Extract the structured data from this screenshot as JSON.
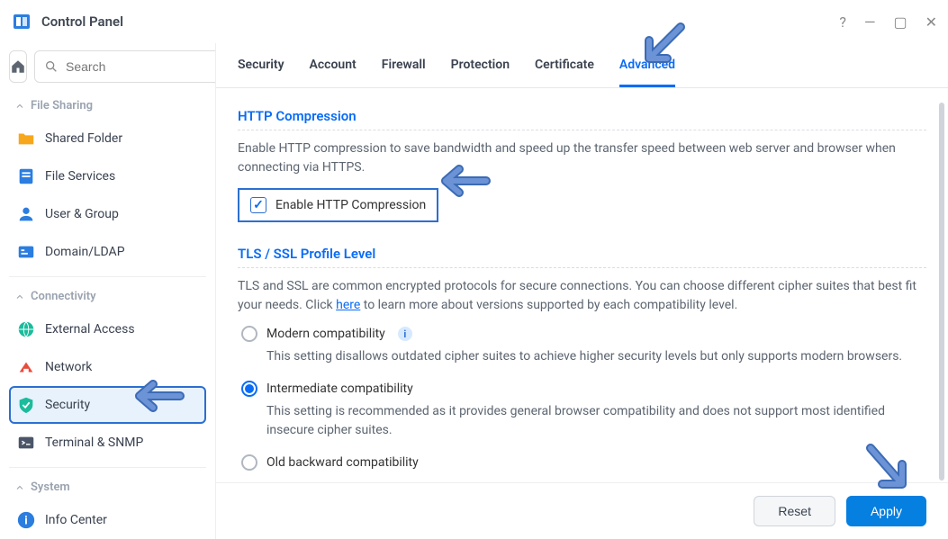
{
  "titlebar": {
    "title": "Control Panel"
  },
  "search": {
    "placeholder": "Search"
  },
  "sidebar": {
    "sections": [
      {
        "label": "File Sharing",
        "items": [
          {
            "label": "Shared Folder",
            "icon": "folder"
          },
          {
            "label": "File Services",
            "icon": "file-services"
          },
          {
            "label": "User & Group",
            "icon": "user-group"
          },
          {
            "label": "Domain/LDAP",
            "icon": "domain"
          }
        ]
      },
      {
        "label": "Connectivity",
        "items": [
          {
            "label": "External Access",
            "icon": "globe"
          },
          {
            "label": "Network",
            "icon": "network"
          },
          {
            "label": "Security",
            "icon": "shield",
            "active": true
          },
          {
            "label": "Terminal & SNMP",
            "icon": "terminal"
          }
        ]
      },
      {
        "label": "System",
        "items": [
          {
            "label": "Info Center",
            "icon": "info"
          }
        ]
      }
    ]
  },
  "tabs": [
    "Security",
    "Account",
    "Firewall",
    "Protection",
    "Certificate",
    "Advanced"
  ],
  "active_tab": "Advanced",
  "http_section": {
    "title": "HTTP Compression",
    "desc": "Enable HTTP compression to save bandwidth and speed up the transfer speed between web server and browser when connecting via HTTPS.",
    "checkbox_label": "Enable HTTP Compression",
    "checked": true
  },
  "tls_section": {
    "title": "TLS / SSL Profile Level",
    "desc_pre": "TLS and SSL are common encrypted protocols for secure connections. You can choose different cipher suites that best fit your needs. Click ",
    "link": "here",
    "desc_post": " to learn more about versions supported by each compatibility level.",
    "options": [
      {
        "label": "Modern compatibility",
        "info": true,
        "desc": "This setting disallows outdated cipher suites to achieve higher security levels but only supports modern browsers."
      },
      {
        "label": "Intermediate compatibility",
        "selected": true,
        "desc": "This setting is recommended as it provides general browser compatibility and does not support most identified insecure cipher suites."
      },
      {
        "label": "Old backward compatibility"
      }
    ]
  },
  "footer": {
    "reset": "Reset",
    "apply": "Apply"
  }
}
